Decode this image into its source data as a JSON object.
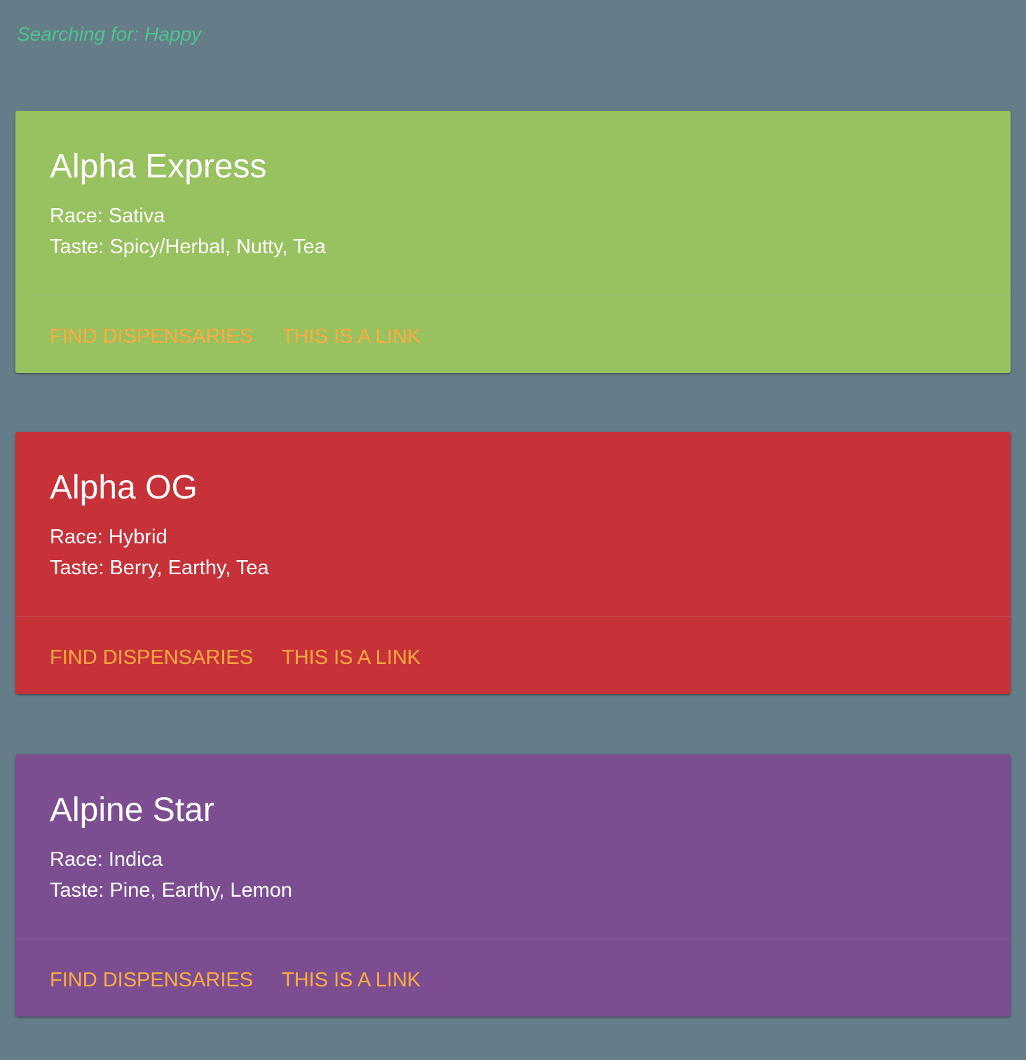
{
  "search": {
    "label": "Searching for: Happy"
  },
  "cards": [
    {
      "title": "Alpha Express",
      "race": "Race: Sativa",
      "taste": "Taste: Spicy/Herbal, Nutty, Tea",
      "color": "#98c15f",
      "actions": {
        "find": "FIND DISPENSARIES",
        "link": "THIS IS A LINK"
      }
    },
    {
      "title": "Alpha OG",
      "race": "Race: Hybrid",
      "taste": "Taste: Berry, Earthy, Tea",
      "color": "#c73138",
      "actions": {
        "find": "FIND DISPENSARIES",
        "link": "THIS IS A LINK"
      }
    },
    {
      "title": "Alpine Star",
      "race": "Race: Indica",
      "taste": "Taste: Pine, Earthy, Lemon",
      "color": "#7c4e91",
      "actions": {
        "find": "FIND DISPENSARIES",
        "link": "THIS IS A LINK"
      }
    }
  ],
  "colors": {
    "page_background": "#657d88",
    "search_text": "#4fc28d",
    "card_text": "#ffffff",
    "action_link": "#ffab40"
  }
}
